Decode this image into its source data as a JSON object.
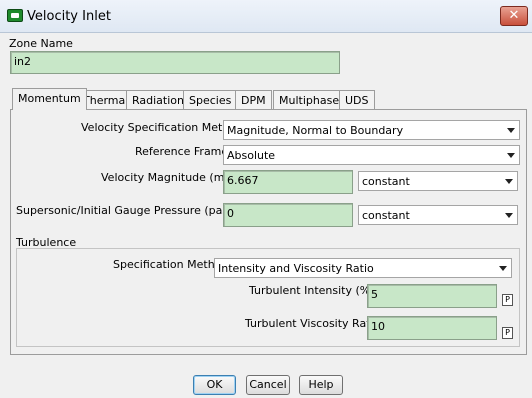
{
  "window": {
    "title": "Velocity Inlet",
    "close_symbol": "✕"
  },
  "zone": {
    "label": "Zone Name",
    "value": "in2"
  },
  "tabs": [
    {
      "label": "Momentum",
      "active": true
    },
    {
      "label": "Thermal"
    },
    {
      "label": "Radiation"
    },
    {
      "label": "Species"
    },
    {
      "label": "DPM"
    },
    {
      "label": "Multiphase"
    },
    {
      "label": "UDS"
    }
  ],
  "momentum": {
    "velocity_spec_method": {
      "label": "Velocity Specification Method",
      "value": "Magnitude, Normal to Boundary"
    },
    "reference_frame": {
      "label": "Reference Frame",
      "value": "Absolute"
    },
    "velocity_magnitude": {
      "label": "Velocity Magnitude (m/s)",
      "value": "6.667",
      "profile": "constant"
    },
    "gauge_pressure": {
      "label": "Supersonic/Initial Gauge Pressure (pascal)",
      "value": "0",
      "profile": "constant"
    }
  },
  "turbulence": {
    "group_label": "Turbulence",
    "spec_method": {
      "label": "Specification Method",
      "value": "Intensity and Viscosity Ratio"
    },
    "intensity": {
      "label": "Turbulent Intensity (%)",
      "value": "5",
      "param_button": "P"
    },
    "viscosity_ratio": {
      "label": "Turbulent Viscosity Ratio",
      "value": "10",
      "param_button": "P"
    }
  },
  "buttons": {
    "ok": "OK",
    "cancel": "Cancel",
    "help": "Help"
  },
  "colors": {
    "field_bg": "#c8e7c8",
    "close_btn": "#c8503c",
    "window_bg": "#f0f0f0"
  }
}
